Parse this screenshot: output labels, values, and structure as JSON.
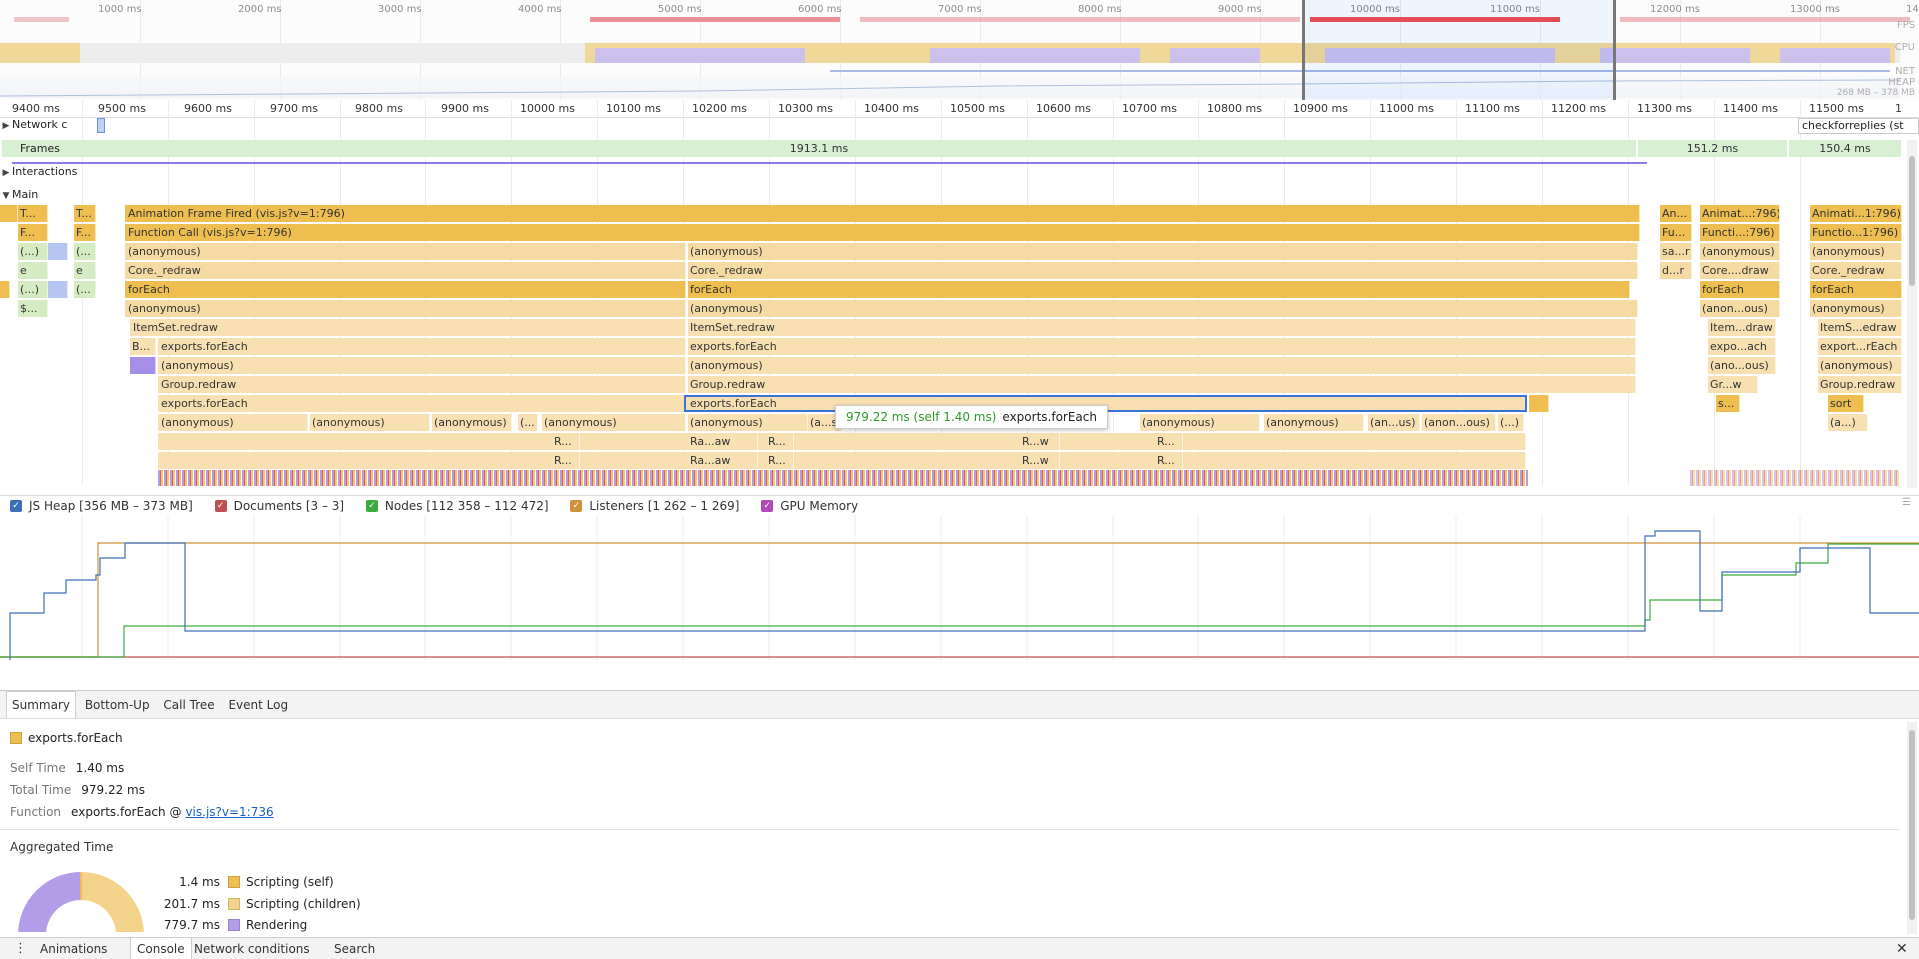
{
  "overview": {
    "ticks": [
      "1000 ms",
      "2000 ms",
      "3000 ms",
      "4000 ms",
      "5000 ms",
      "6000 ms",
      "7000 ms",
      "8000 ms",
      "9000 ms",
      "10000 ms",
      "11000 ms",
      "12000 ms",
      "13000 ms",
      "14"
    ],
    "labels": {
      "fps": "FPS",
      "cpu": "CPU",
      "net": "NET",
      "heap": "HEAP",
      "heap_range": "268 MB – 378 MB"
    }
  },
  "ruler": {
    "ticks": [
      "9400 ms",
      "9500 ms",
      "9600 ms",
      "9700 ms",
      "9800 ms",
      "9900 ms",
      "10000 ms",
      "10100 ms",
      "10200 ms",
      "10300 ms",
      "10400 ms",
      "10500 ms",
      "10600 ms",
      "10700 ms",
      "10800 ms",
      "10900 ms",
      "11000 ms",
      "11100 ms",
      "11200 ms",
      "11300 ms",
      "11400 ms",
      "11500 ms",
      "1"
    ]
  },
  "tracks": {
    "network": "Network c",
    "network_request": "checkforreplies (st",
    "frames": "Frames",
    "frame_times": [
      "1913.1 ms",
      "151.2 ms",
      "150.4 ms"
    ],
    "interactions": "Interactions",
    "main": "Main"
  },
  "flame": {
    "left_cols": [
      [
        "T...",
        "T..."
      ],
      [
        "F...",
        "F..."
      ],
      [
        "(...)",
        "(..."
      ],
      [
        "e",
        "e"
      ],
      [
        "(...)",
        "(..."
      ],
      [
        "$...",
        ""
      ]
    ],
    "rows": [
      {
        "a": "Animation Frame Fired (vis.js?v=1:796)",
        "b": "",
        "r1": "An...",
        "r2": "Animat...:796)",
        "r3": "Animati...1:796)"
      },
      {
        "a": "Function Call (vis.js?v=1:796)",
        "b": "",
        "r1": "Fu...",
        "r2": "Functi...:796)",
        "r3": "Functio...1:796)"
      },
      {
        "a": "(anonymous)",
        "b": "(anonymous)",
        "r1": "sa...r",
        "r2": "(anonymous)",
        "r3": "(anonymous)"
      },
      {
        "a": "Core._redraw",
        "b": "Core._redraw",
        "r1": "d...r",
        "r2": "Core....draw",
        "r3": "Core._redraw"
      },
      {
        "a": "forEach",
        "b": "forEach",
        "r1": "",
        "r2": "forEach",
        "r3": "forEach"
      },
      {
        "a": "(anonymous)",
        "b": "(anonymous)",
        "r1": "",
        "r2": "(anon...ous)",
        "r3": "(anonymous)"
      },
      {
        "a": "ItemSet.redraw",
        "b": "ItemSet.redraw",
        "r1": "",
        "r2": "Item...draw",
        "r3": "ItemS...edraw"
      },
      {
        "a": "exports.forEach",
        "b": "exports.forEach",
        "r1": "",
        "r2": "expo...ach",
        "r3": "export...rEach"
      },
      {
        "a": "(anonymous)",
        "b": "(anonymous)",
        "r1": "",
        "r2": "(ano...ous)",
        "r3": "(anonymous)"
      },
      {
        "a": "Group.redraw",
        "b": "Group.redraw",
        "r1": "",
        "r2": "Gr...w",
        "r3": "Group.redraw"
      },
      {
        "a": "exports.forEach",
        "b": "exports.forEach",
        "r1": "",
        "r2": "s...",
        "r3": "sort"
      }
    ],
    "b_small": "B...",
    "row11": [
      "(anonymous)",
      "(anonymous)",
      "(anonymous)",
      "(...",
      "(anonymous)",
      "(anonymous)",
      "(a...s)",
      "(anonymous)",
      "(anonymous)",
      "(an...us)",
      "(anon...ous)",
      "(...)",
      "(a...)"
    ],
    "row12": [
      "R...",
      "Ra...aw",
      "R...",
      "R...w",
      "R..."
    ],
    "row13": [
      "R...",
      "Ra...aw",
      "R...",
      "R...w",
      "R..."
    ]
  },
  "tooltip": {
    "time": "979.22 ms (self 1.40 ms)",
    "name": "exports.forEach"
  },
  "memory": {
    "counters": [
      {
        "label": "JS Heap [356 MB – 373 MB]",
        "color": "#3d6fb8"
      },
      {
        "label": "Documents [3 – 3]",
        "color": "#c05050"
      },
      {
        "label": "Nodes [112 358 – 112 472]",
        "color": "#3caa3c"
      },
      {
        "label": "Listeners [1 262 – 1 269]",
        "color": "#d0913a"
      },
      {
        "label": "GPU Memory",
        "color": "#b04ab8"
      }
    ]
  },
  "tabs": [
    "Summary",
    "Bottom-Up",
    "Call Tree",
    "Event Log"
  ],
  "summary": {
    "title": "exports.forEach",
    "swatch": "#eebf50",
    "self_time_label": "Self Time",
    "self_time": "1.40 ms",
    "total_time_label": "Total Time",
    "total_time": "979.22 ms",
    "function_label": "Function",
    "function_name": "exports.forEach @ ",
    "function_link": "vis.js?v=1:736",
    "aggregated_title": "Aggregated Time",
    "aggregated": [
      {
        "value": "1.4 ms",
        "label": "Scripting (self)",
        "color": "#eebf50"
      },
      {
        "value": "201.7 ms",
        "label": "Scripting (children)",
        "color": "#f3d38a"
      },
      {
        "value": "779.7 ms",
        "label": "Rendering",
        "color": "#b39ce8"
      }
    ]
  },
  "drawer": {
    "tabs": [
      "Animations",
      "Console",
      "Network conditions",
      "Search"
    ]
  }
}
